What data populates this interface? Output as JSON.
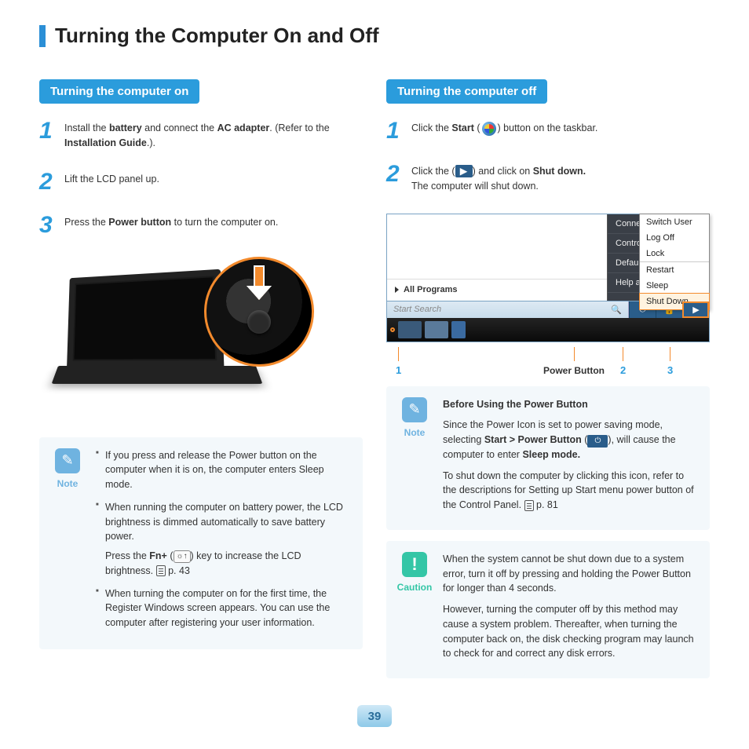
{
  "page_title": "Turning the Computer On and Off",
  "page_number": "39",
  "left": {
    "header": "Turning the computer on",
    "steps": {
      "s1_a": "Install the ",
      "s1_b1": "battery",
      "s1_c": " and connect the ",
      "s1_b2": "AC adapter",
      "s1_d": ". (Refer to the ",
      "s1_b3": "Installation Guide",
      "s1_e": ".).",
      "s2": "Lift the LCD panel up.",
      "s3_a": "Press the ",
      "s3_b": "Power button",
      "s3_c": " to turn the computer on."
    },
    "note": {
      "label": "Note",
      "li1": "If you press and release the Power button on the computer when it is on, the computer enters Sleep mode.",
      "li2": "When running the computer on battery power, the LCD brightness is dimmed automatically to save battery power.",
      "li2b_a": "Press the ",
      "li2b_fn": "Fn+",
      "li2b_b": " (",
      "li2b_c": ") key to increase the LCD brightness. ",
      "li2b_pref": " p. 43",
      "li3": "When turning the computer on for the first time, the Register Windows screen appears. You can use the computer after registering your user information."
    }
  },
  "right": {
    "header": "Turning the computer off",
    "steps": {
      "s1_a": "Click the ",
      "s1_b": "Start",
      "s1_c": " (",
      "s1_d": ") button on the taskbar.",
      "s2_a": "Click the (",
      "s2_b": ") and click on ",
      "s2_c": "Shut down.",
      "s2_d": "The computer will shut down."
    },
    "menu": {
      "right_items": [
        "Connect To",
        "Control Panel",
        "Default Programs",
        "Help and Support"
      ],
      "fly_items": [
        "Switch User",
        "Log Off",
        "Lock",
        "Restart",
        "Sleep",
        "Shut Down"
      ],
      "all_programs": "All Programs",
      "search_placeholder": "Start Search"
    },
    "annot": {
      "a1": "1",
      "pb": "Power Button",
      "a2": "2",
      "a3": "3"
    },
    "note": {
      "label": "Note",
      "title": "Before Using the Power Button",
      "p1_a": "Since the Power Icon is set to power saving mode, selecting ",
      "p1_b": "Start > Power Button",
      "p1_c": " (",
      "p1_d": "), will cause the computer to enter ",
      "p1_e": "Sleep mode.",
      "p2": "To shut down the computer by clicking this icon, refer to the descriptions for Setting up Start menu power button of the Control Panel. ",
      "p2_ref": " p. 81"
    },
    "caution": {
      "label": "Caution",
      "p1": "When the system cannot be shut down due to a system error, turn it off by pressing and holding the Power Button for longer than 4 seconds.",
      "p2": "However, turning the computer off by this method may cause a system problem. Thereafter, when turning the computer back on, the disk checking program may launch to check for and correct any disk errors."
    }
  }
}
